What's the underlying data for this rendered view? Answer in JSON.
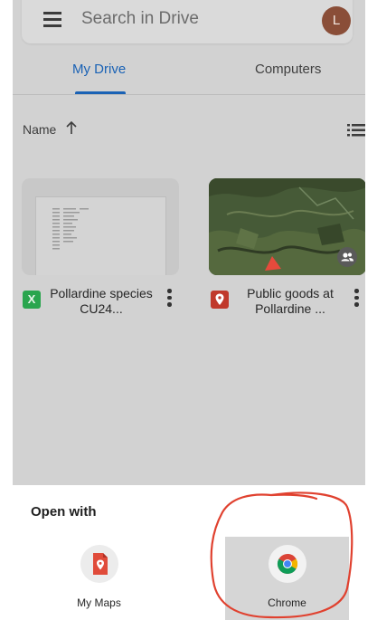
{
  "search": {
    "placeholder": "Search in Drive",
    "avatar_initial": "L"
  },
  "tabs": [
    {
      "label": "My Drive",
      "selected": true
    },
    {
      "label": "Computers",
      "selected": false
    }
  ],
  "sort": {
    "label": "Name",
    "direction_icon": "arrow-up-icon",
    "view_icon": "list-view-icon"
  },
  "files": [
    {
      "name": "Pollardine species CU24...",
      "type_icon": "sheets-icon",
      "type_glyph": "X"
    },
    {
      "name": "Public goods at Pollardine ...",
      "type_icon": "my-maps-icon",
      "shared_icon": "shared-people-icon"
    }
  ],
  "open_with": {
    "title": "Open with",
    "apps": [
      {
        "label": "My Maps",
        "icon": "my-maps-icon"
      },
      {
        "label": "Chrome",
        "icon": "chrome-icon",
        "highlighted": true
      }
    ]
  },
  "colors": {
    "accent": "#1a62b5",
    "sheets_green": "#2aa54e",
    "maps_red": "#c0392b",
    "annotation_red": "#e0412f"
  }
}
